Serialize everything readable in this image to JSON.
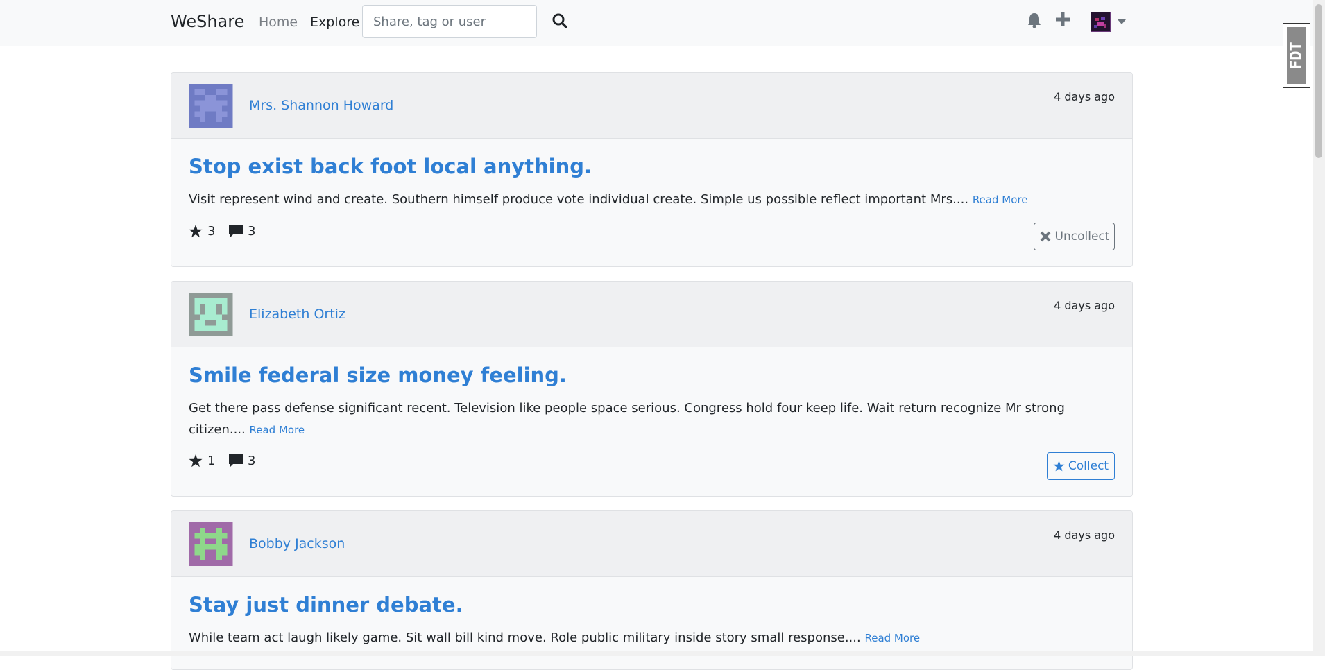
{
  "navbar": {
    "brand": "WeShare",
    "home_label": "Home",
    "explore_label": "Explore",
    "search_placeholder": "Share, tag or user"
  },
  "posts": [
    {
      "author": "Mrs. Shannon Howard",
      "time": "4 days ago",
      "title": "Stop exist back foot local anything.",
      "excerpt": "Visit represent wind and create. Southern himself produce vote individual create. Simple us possible reflect important Mrs....",
      "read_more": "Read More",
      "stars": "3",
      "comments": "3",
      "action_label": "Uncollect",
      "avatar_color": "#6f7bc4"
    },
    {
      "author": "Elizabeth Ortiz",
      "time": "4 days ago",
      "title": "Smile federal size money feeling.",
      "excerpt": "Get there pass defense significant recent. Television like people space serious. Congress hold four keep life. Wait return recognize Mr strong citizen....",
      "read_more": "Read More",
      "stars": "1",
      "comments": "3",
      "action_label": "Collect",
      "avatar_color": "#a8ecd0"
    },
    {
      "author": "Bobby Jackson",
      "time": "4 days ago",
      "title": "Stay just dinner debate.",
      "excerpt": "While team act laugh likely game. Sit wall bill kind move. Role public military inside story small response....",
      "read_more": "Read More",
      "avatar_color": "#8ed88a"
    }
  ],
  "extension_badge": "FDT",
  "colors": {
    "link": "#2f7fd4",
    "navbar_bg": "#f8f9fa",
    "card_header_bg": "#eff0f2"
  }
}
